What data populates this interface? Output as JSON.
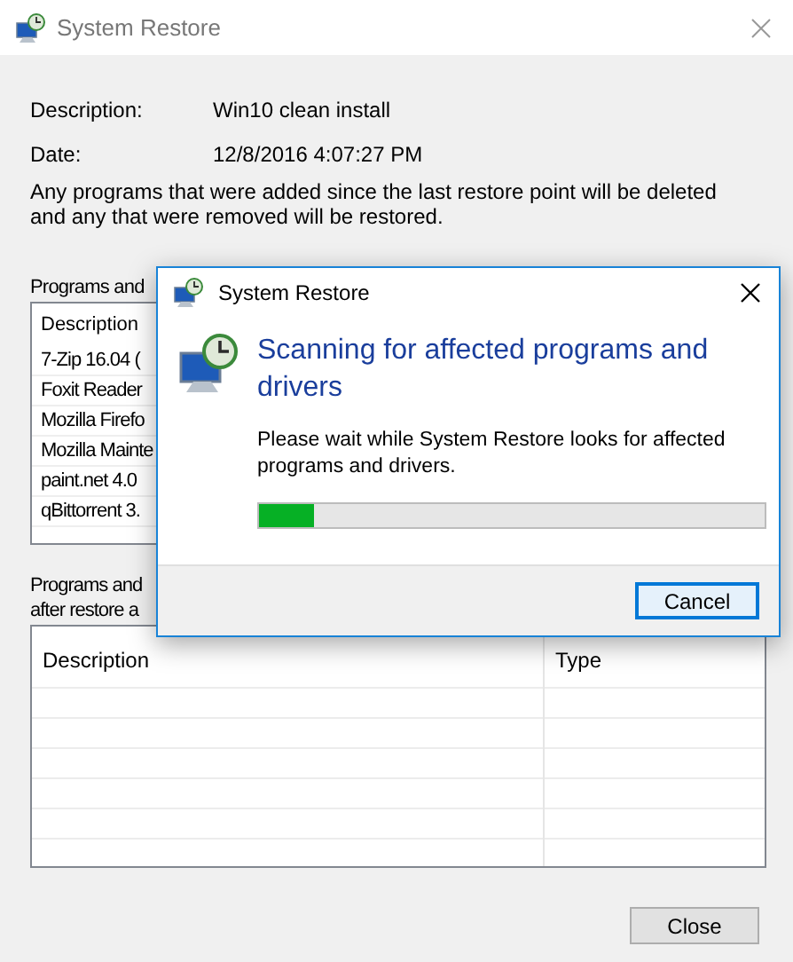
{
  "window": {
    "title": "System Restore"
  },
  "fields": [
    {
      "label": "Description:",
      "value": "Win10 clean install"
    },
    {
      "label": "Date:",
      "value": "12/8/2016 4:07:27 PM"
    }
  ],
  "note": "Any programs that were added since the last restore point will be deleted and any that were removed will be restored.",
  "deleted_list": {
    "caption": "Programs and",
    "column": "Description",
    "rows": [
      "7-Zip 16.04 (",
      "Foxit Reader",
      "Mozilla Firefo",
      "Mozilla Mainte",
      "paint.net 4.0",
      "qBittorrent 3."
    ]
  },
  "restored_list": {
    "caption_lines": [
      "Programs and",
      "after restore a"
    ],
    "columns": [
      "Description",
      "Type"
    ]
  },
  "close_button": "Close",
  "dialog": {
    "title": "System Restore",
    "heading": "Scanning for affected programs and drivers",
    "message": "Please wait while System Restore looks for affected programs and drivers.",
    "progress": {
      "level": 0.11
    },
    "cancel_button": "Cancel"
  }
}
